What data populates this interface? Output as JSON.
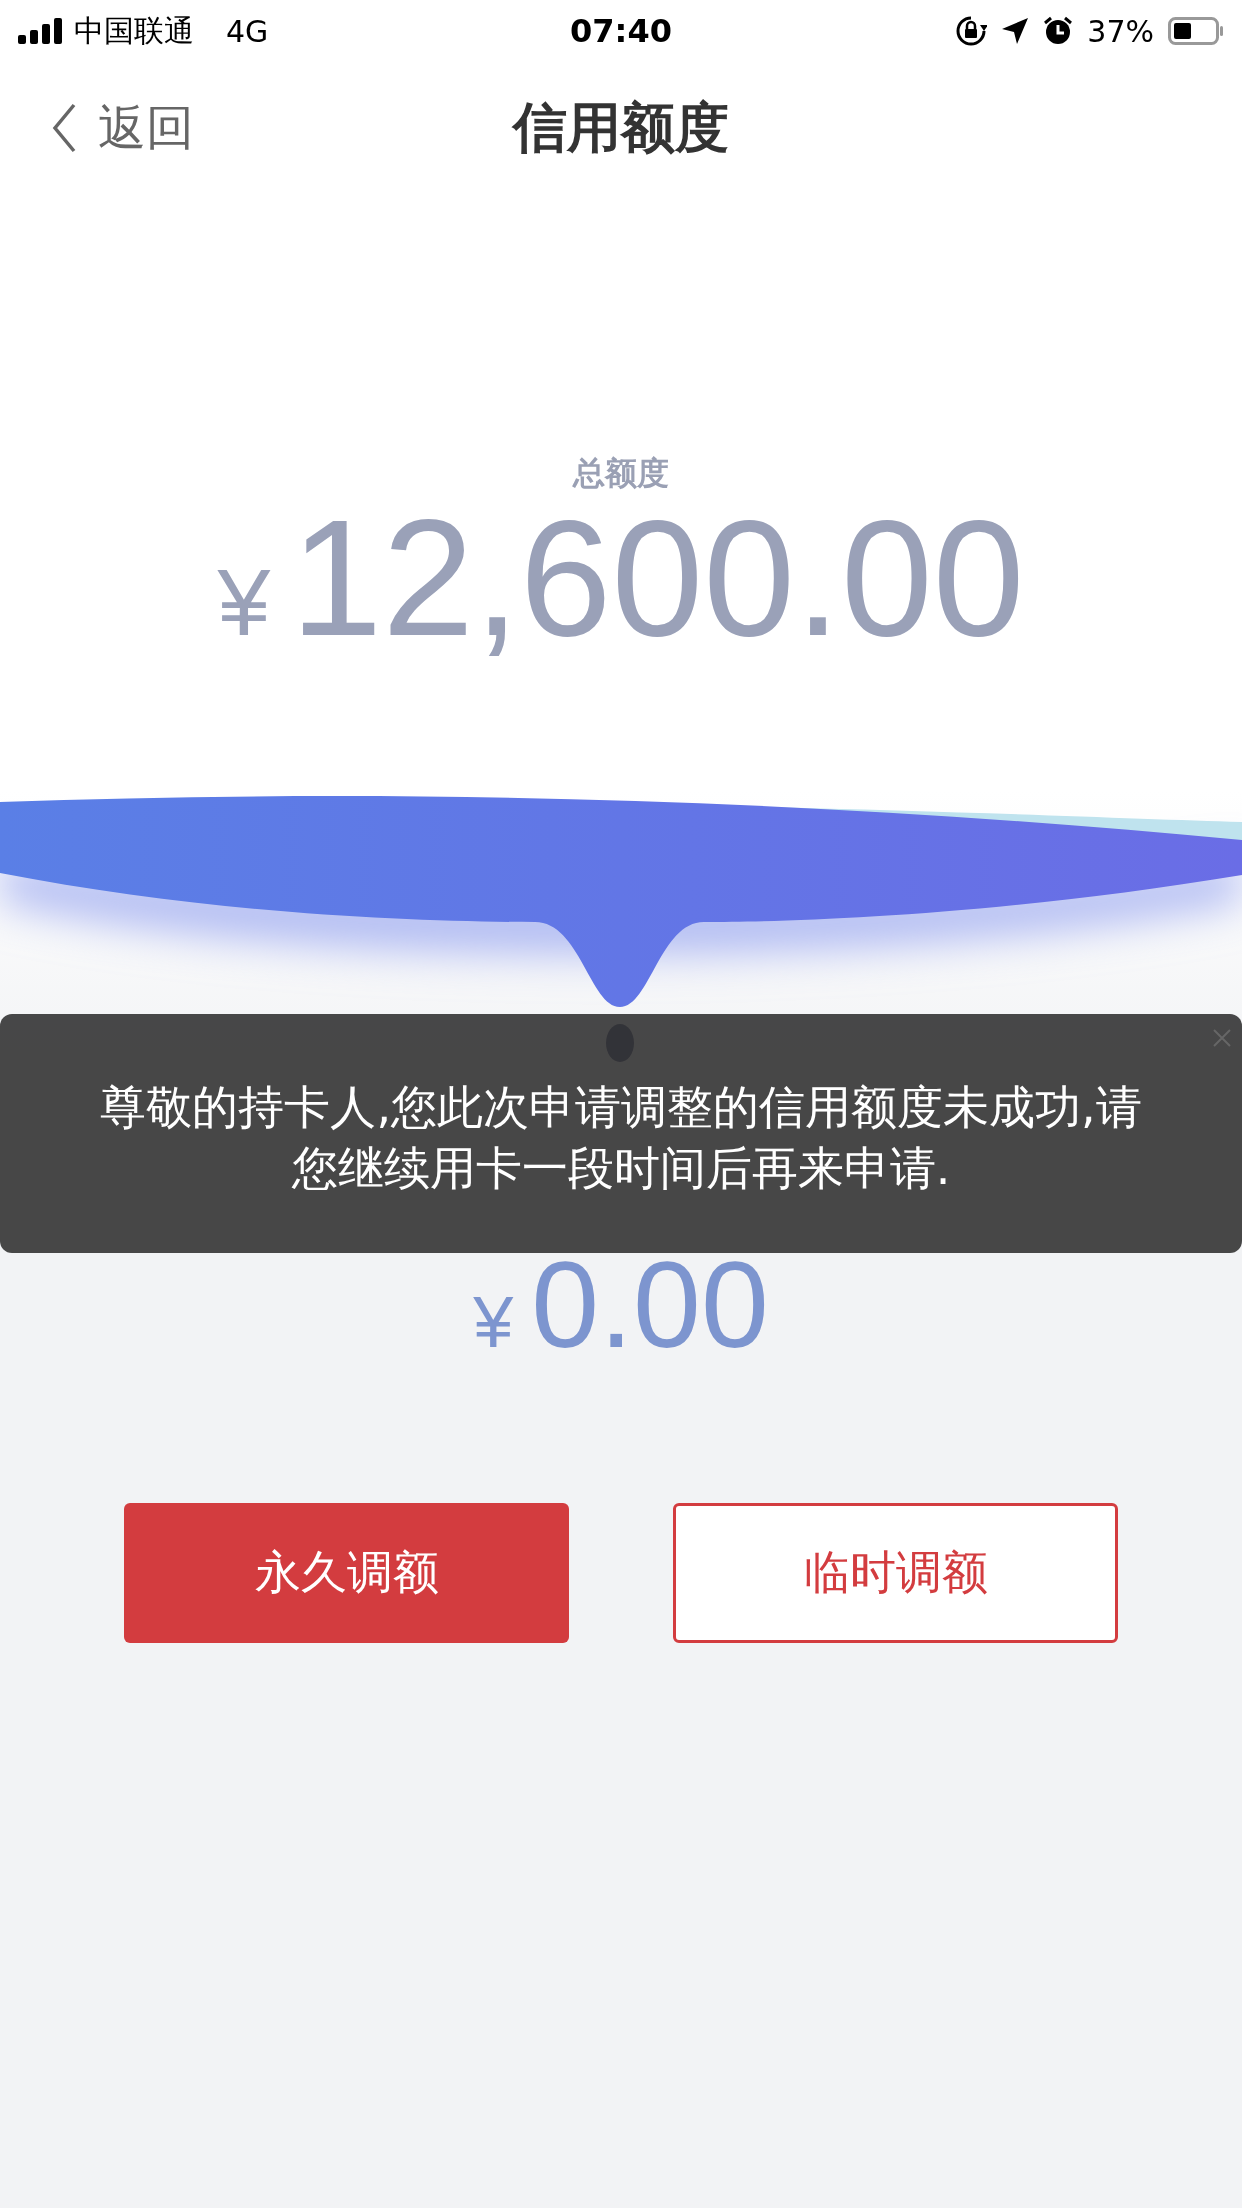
{
  "status_bar": {
    "carrier": "中国联通",
    "network": "4G",
    "time": "07:40",
    "battery": "37%"
  },
  "nav": {
    "back": "返回",
    "title": "信用额度"
  },
  "total": {
    "label": "总额度",
    "currency": "¥",
    "amount": "12,600.00"
  },
  "available": {
    "currency": "¥",
    "amount": "0.00"
  },
  "toast": {
    "message": "尊敬的持卡人,您此次申请调整的信用额度未成功,请您继续用卡一段时间后再来申请."
  },
  "buttons": [
    {
      "label": "永久调额",
      "kind": "primary"
    },
    {
      "label": "临时调额",
      "kind": "outline"
    }
  ]
}
